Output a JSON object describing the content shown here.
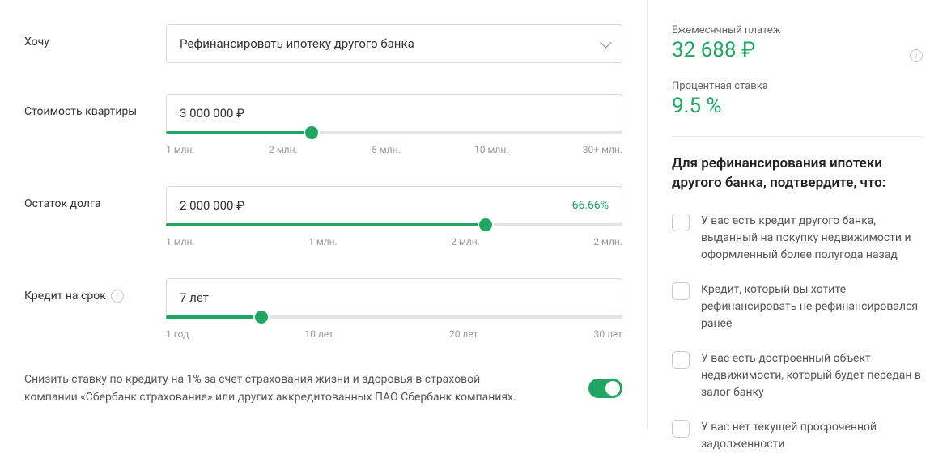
{
  "left": {
    "purpose": {
      "label": "Хочу",
      "value": "Рефинансировать ипотеку другого банка"
    },
    "property_cost": {
      "label": "Стоимость квартиры",
      "value": "3 000 000 ₽",
      "ticks": [
        "1 млн.",
        "2 млн.",
        "5 млн.",
        "10 млн.",
        "30+ млн."
      ],
      "fill_pct": 32
    },
    "debt_remaining": {
      "label": "Остаток долга",
      "value": "2 000 000 ₽",
      "hint": "66.66%",
      "ticks": [
        "1 млн.",
        "1 млн.",
        "2 млн.",
        "2 млн."
      ],
      "fill_pct": 70
    },
    "term": {
      "label": "Кредит на срок",
      "value": "7 лет",
      "ticks": [
        "1 год",
        "10 лет",
        "20 лет",
        "30 лет"
      ],
      "fill_pct": 21
    },
    "insurance": {
      "text": "Снизить ставку по кредиту на 1% за счет страхования жизни и здоровья в страховой компании «Сбербанк страхование» или других аккредитованных ПАО Сбербанк компаниях.",
      "enabled": true
    }
  },
  "right": {
    "monthly": {
      "label": "Ежемесячный платеж",
      "value": "32 688 ₽"
    },
    "rate": {
      "label": "Процентная ставка",
      "value": "9.5 %"
    },
    "confirm_title": "Для рефинансирования ипотеки другого банка, подтвердите, что:",
    "checks": [
      "У вас есть кредит другого банка, выданный на покупку недвижимости и оформленный более полугода назад",
      "Кредит, который вы хотите рефинансировать не рефинансировался ранее",
      "У вас есть достроенный объект недвижимости, который будет передан в залог банку",
      "У вас нет текущей просроченной задолженности"
    ]
  }
}
